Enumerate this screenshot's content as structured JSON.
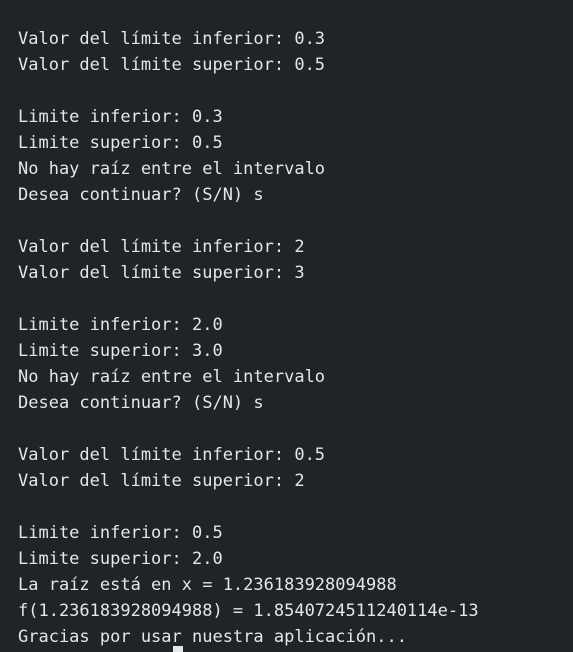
{
  "terminal": {
    "lines": [
      "Valor del límite inferior: 0.3",
      "Valor del límite superior: 0.5",
      "",
      "Limite inferior: 0.3",
      "Limite superior: 0.5",
      "No hay raíz entre el intervalo",
      "Desea continuar? (S/N) s",
      "",
      "Valor del límite inferior: 2",
      "Valor del límite superior: 3",
      "",
      "Limite inferior: 2.0",
      "Limite superior: 3.0",
      "No hay raíz entre el intervalo",
      "Desea continuar? (S/N) s",
      "",
      "Valor del límite inferior: 0.5",
      "Valor del límite superior: 2",
      "",
      "Limite inferior: 0.5",
      "Limite superior: 2.0",
      "La raíz está en x = 1.236183928094988",
      "f(1.236183928094988) = 1.8540724511240114e-13",
      "Gracias por usar nuestra aplicación..."
    ]
  },
  "colors": {
    "background": "#1f2428",
    "foreground": "#e6e6e6"
  }
}
